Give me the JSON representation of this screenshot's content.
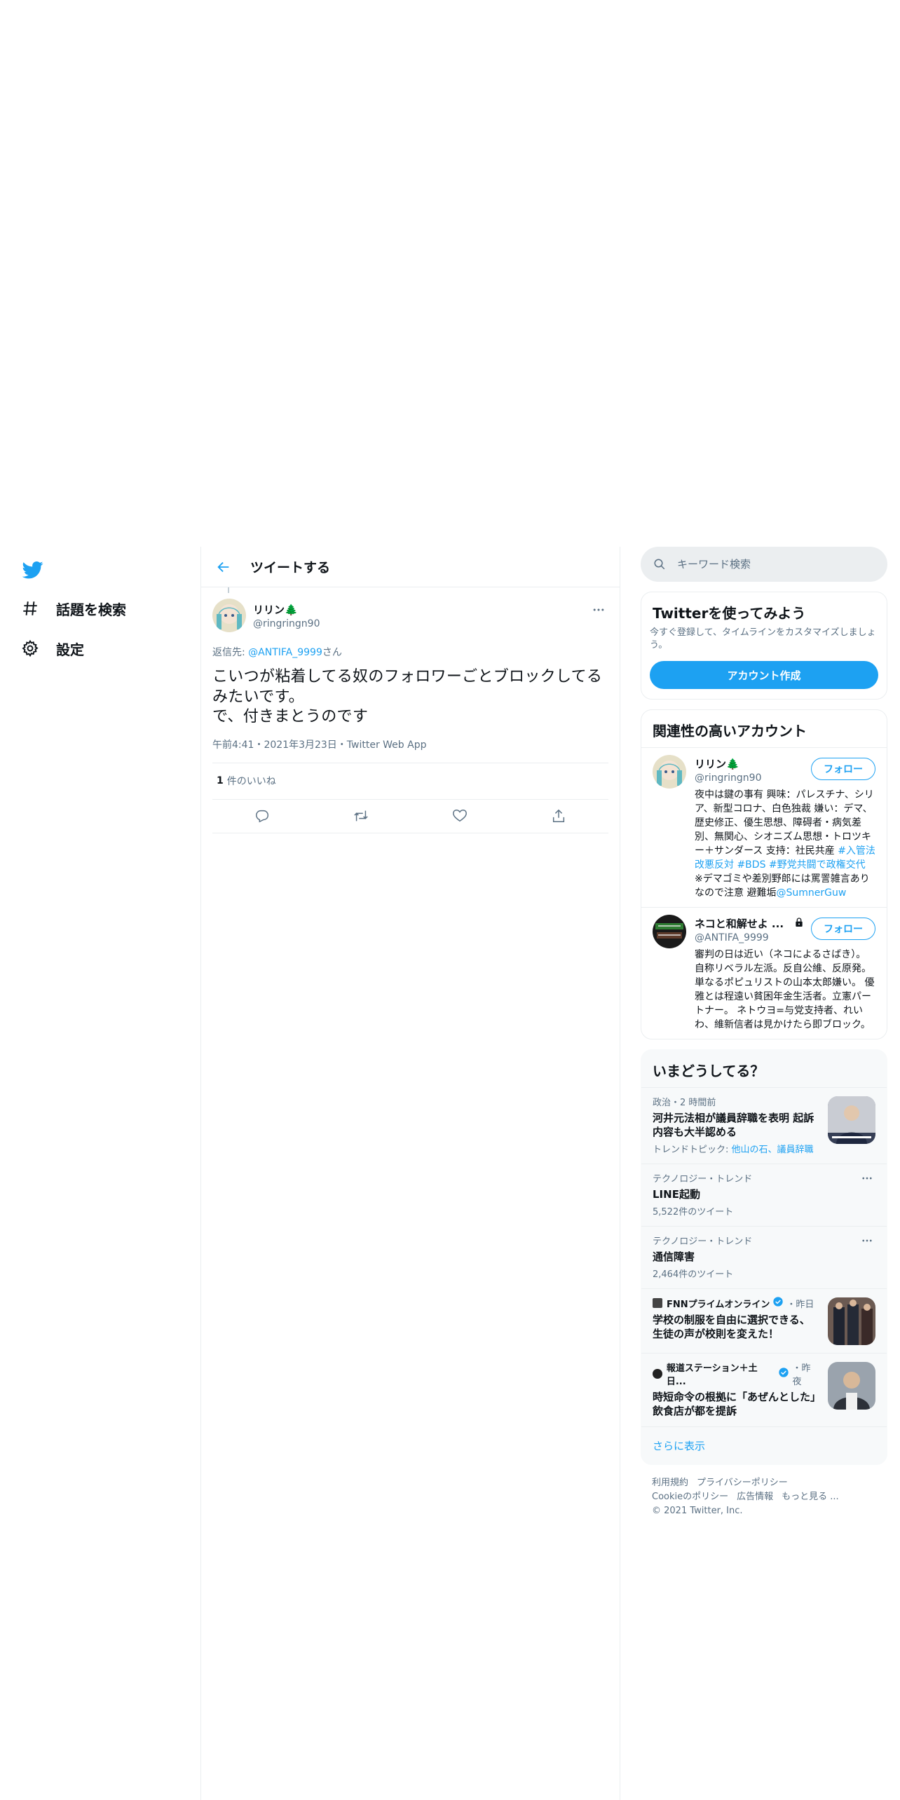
{
  "nav": {
    "explore_label": "話題を検索",
    "settings_label": "設定"
  },
  "header": {
    "title": "ツイートする"
  },
  "tweet": {
    "author_name": "リリン🌲",
    "author_handle": "@ringringn90",
    "reply_prefix": "返信先: ",
    "reply_to_handle": "@ANTIFA_9999",
    "reply_suffix": "さん",
    "text": "こいつが粘着してる奴のフォロワーごとブロックしてるみたいです。\nで、付きまとうのです",
    "timestamp": "午前4:41・2021年3月23日・Twitter Web App",
    "likes_count": "1",
    "likes_label": "件のいいね"
  },
  "search": {
    "placeholder": "キーワード検索"
  },
  "signup": {
    "title": "Twitterを使ってみよう",
    "description": "今すぐ登録して、タイムラインをカスタマイズしましょう。",
    "button_label": "アカウント作成"
  },
  "related": {
    "title": "関連性の高いアカウント",
    "follow_label": "フォロー",
    "accounts": [
      {
        "name": "リリン🌲",
        "handle": "@ringringn90",
        "bio_text": "夜中は鍵の事有 興味：パレスチナ、シリア、新型コロナ、白色独裁 嫌い：デマ、歴史修正、優生思想、障碍者・病気差別、無関心、シオニズム思想・トロツキー＋サンダース 支持：社民共産 ",
        "bio_tag1": "#入管法改悪反対",
        "bio_tag2": "#BDS",
        "bio_tag3": "#野党共闘で政権交代",
        "bio_tail": " ※デマゴミや差別野郎には罵詈雑言ありなので注意 避難垢",
        "bio_mention": "@SumnerGuw"
      },
      {
        "name": "ネコと和解せよ ...",
        "handle": "@ANTIFA_9999",
        "bio_text": "審判の日は近い（ネコによるさばき）。 自称リベラル左派。反自公維、反原発。 単なるポピュリストの山本太郎嫌い。 優雅とは程遠い貧困年金生活者。立憲パートナー。 ネトウヨ=与党支持者、れいわ、維新信者は見かけたら即ブロック。"
      }
    ]
  },
  "trends": {
    "title": "いまどうしてる？",
    "items": [
      {
        "meta": "政治・2 時間前",
        "title": "河井元法相が議員辞職を表明 起訴内容も大半認める",
        "sub_prefix": "トレンドトピック: ",
        "sub_link": "他山の石、議員辞職"
      },
      {
        "meta": "テクノロジー・トレンド",
        "title": "LINE起動",
        "sub": "5,522件のツイート"
      },
      {
        "meta": "テクノロジー・トレンド",
        "title": "通信障害",
        "sub": "2,464件のツイート"
      },
      {
        "source": "FNNプライムオンライン",
        "time": "・昨日",
        "title": "学校の制服を自由に選択できる、生徒の声が校則を変えた！"
      },
      {
        "source": "報道ステーション＋土日...",
        "time": "・昨夜",
        "title": "時短命令の根拠に「あぜんとした」飲食店が都を提訴"
      }
    ],
    "show_more": "さらに表示"
  },
  "footer": {
    "terms": "利用規約",
    "privacy": "プライバシーポリシー",
    "cookie": "Cookieのポリシー",
    "ads": "広告情報",
    "more": "もっと見る ...",
    "copyright": "© 2021 Twitter, Inc."
  },
  "colors": {
    "accent": "#1da1f2",
    "muted": "#5b7083",
    "border": "#ebeef0"
  }
}
